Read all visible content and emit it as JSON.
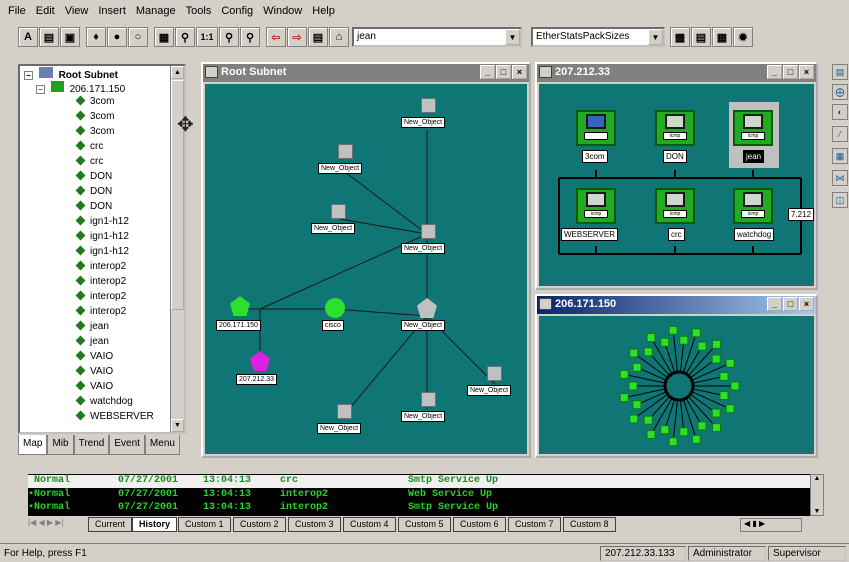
{
  "menu": [
    "File",
    "Edit",
    "View",
    "Insert",
    "Manage",
    "Tools",
    "Config",
    "Window",
    "Help"
  ],
  "toolbar": {
    "zoom_label": "1:1",
    "user_combo": "jean",
    "pack_combo": "EtherStatsPackSizes"
  },
  "tree": {
    "root": "Root Subnet",
    "subnet": "206.171.150",
    "items": [
      "3com",
      "3com",
      "3com",
      "crc",
      "crc",
      "DON",
      "DON",
      "DON",
      "ign1-h12",
      "ign1-h12",
      "ign1-h12",
      "interop2",
      "interop2",
      "interop2",
      "interop2",
      "jean",
      "jean",
      "VAIO",
      "VAIO",
      "VAIO",
      "watchdog",
      "WEBSERVER"
    ]
  },
  "left_tabs": [
    "Map",
    "Mib",
    "Trend",
    "Event",
    "Menu"
  ],
  "win_root": {
    "title": "Root Subnet",
    "objects": [
      "New_Object",
      "New_Object",
      "New_Object",
      "New_Object",
      "New_Object",
      "New_Object",
      "New_Object",
      "New_Object"
    ],
    "ip_green": "206.171.150",
    "cisco": "cisco",
    "ip_magenta": "207.212.33"
  },
  "win_207": {
    "title": "207.212.33",
    "hosts": [
      "3com",
      "DON",
      "jean",
      "WEBSERVER",
      "crc",
      "watchdog"
    ],
    "side_label": "7.212"
  },
  "win_206": {
    "title": "206.171.150"
  },
  "events": [
    {
      "status": "Normal",
      "date": "07/27/2001",
      "time": "13:04:13",
      "host": "crc",
      "msg": "Smtp Service Up"
    },
    {
      "status": "Normal",
      "date": "07/27/2001",
      "time": "13:04:13",
      "host": "interop2",
      "msg": "Web Service Up"
    },
    {
      "status": "Normal",
      "date": "07/27/2001",
      "time": "13:04:13",
      "host": "interop2",
      "msg": "Smtp Service Up"
    }
  ],
  "bottom_tabs": [
    "Current",
    "History",
    "Custom 1",
    "Custom 2",
    "Custom 3",
    "Custom 4",
    "Custom 5",
    "Custom 6",
    "Custom 7",
    "Custom 8"
  ],
  "status": {
    "help": "For Help, press F1",
    "ip": "207.212.33.133",
    "user": "Administrator",
    "role": "Supervisor"
  }
}
